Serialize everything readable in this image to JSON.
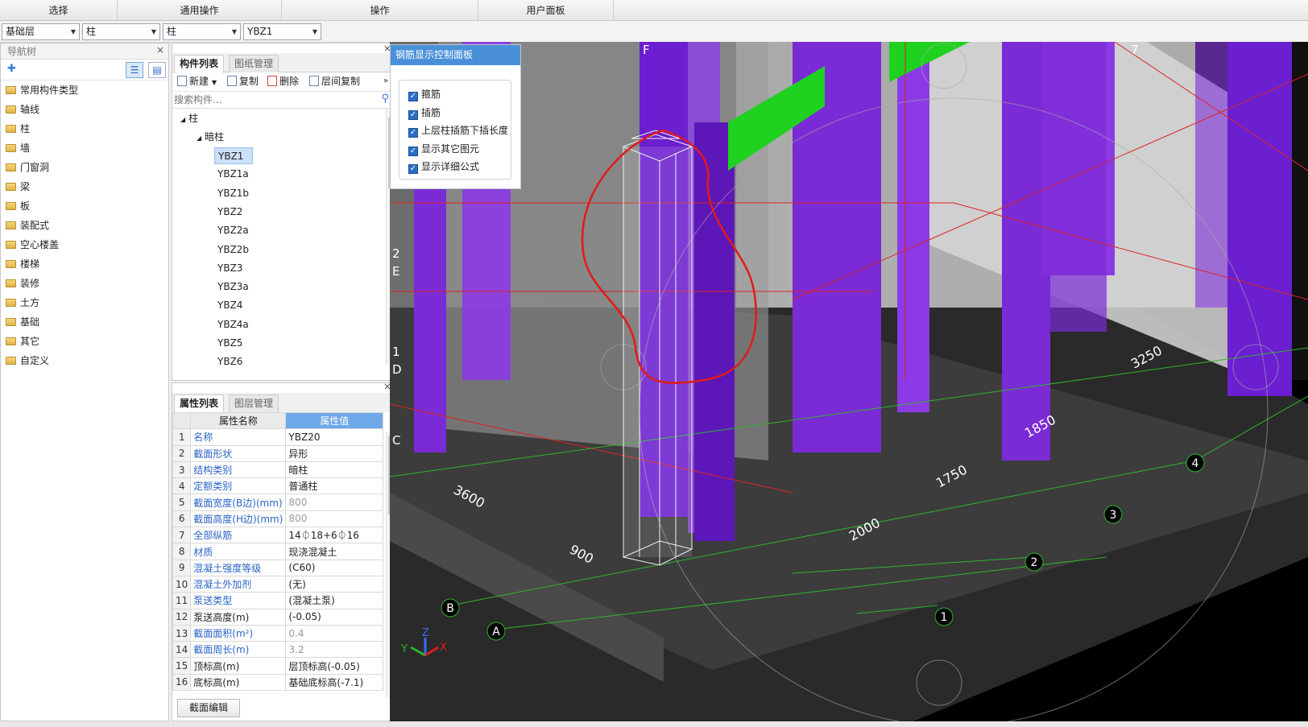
{
  "ribbon": {
    "tabs": [
      "选择",
      "通用操作",
      "操作",
      "用户面板"
    ]
  },
  "combos": {
    "floor": "基础层",
    "category": "柱",
    "subtype": "柱",
    "component": "YBZ1"
  },
  "nav": {
    "title": "导航树",
    "items": [
      "常用构件类型",
      "轴线",
      "柱",
      "墙",
      "门窗洞",
      "梁",
      "板",
      "装配式",
      "空心楼盖",
      "楼梯",
      "装修",
      "土方",
      "基础",
      "其它",
      "自定义"
    ]
  },
  "comp": {
    "tab_active": "构件列表",
    "tab_other": "图纸管理",
    "new_label": "新建",
    "copy_label": "复制",
    "delete_label": "删除",
    "floor_copy_label": "层间复制",
    "search_placeholder": "搜索构件...",
    "root": "柱",
    "group": "暗柱",
    "items": [
      "YBZ1",
      "YBZ1a",
      "YBZ1b",
      "YBZ2",
      "YBZ2a",
      "YBZ2b",
      "YBZ3",
      "YBZ3a",
      "YBZ4",
      "YBZ4a",
      "YBZ5",
      "YBZ6"
    ]
  },
  "props": {
    "tab_active": "属性列表",
    "tab_other": "图层管理",
    "col_name": "属性名称",
    "col_value": "属性值",
    "rows": [
      {
        "n": "1",
        "name": "名称",
        "value": "YBZ20",
        "blue": true,
        "gray": false
      },
      {
        "n": "2",
        "name": "截面形状",
        "value": "异形",
        "blue": true,
        "gray": false
      },
      {
        "n": "3",
        "name": "结构类别",
        "value": "暗柱",
        "blue": true,
        "gray": false
      },
      {
        "n": "4",
        "name": "定额类别",
        "value": "普通柱",
        "blue": true,
        "gray": false
      },
      {
        "n": "5",
        "name": "截面宽度(B边)(mm)",
        "value": "800",
        "blue": true,
        "gray": true
      },
      {
        "n": "6",
        "name": "截面高度(H边)(mm)",
        "value": "800",
        "blue": true,
        "gray": true
      },
      {
        "n": "7",
        "name": "全部纵筋",
        "value": "14⏀18+6⏀16",
        "blue": true,
        "gray": false
      },
      {
        "n": "8",
        "name": "材质",
        "value": "现浇混凝土",
        "blue": true,
        "gray": false
      },
      {
        "n": "9",
        "name": "混凝土强度等级",
        "value": "(C60)",
        "blue": true,
        "gray": false
      },
      {
        "n": "10",
        "name": "混凝土外加剂",
        "value": "(无)",
        "blue": true,
        "gray": false
      },
      {
        "n": "11",
        "name": "泵送类型",
        "value": "(混凝土泵)",
        "blue": true,
        "gray": false
      },
      {
        "n": "12",
        "name": "泵送高度(m)",
        "value": "(-0.05)",
        "blue": false,
        "gray": false
      },
      {
        "n": "13",
        "name": "截面面积(m²)",
        "value": "0.4",
        "blue": true,
        "gray": true
      },
      {
        "n": "14",
        "name": "截面周长(m)",
        "value": "3.2",
        "blue": true,
        "gray": true
      },
      {
        "n": "15",
        "name": "顶标高(m)",
        "value": "层顶标高(-0.05)",
        "blue": false,
        "gray": false
      },
      {
        "n": "16",
        "name": "底标高(m)",
        "value": "基础底标高(-7.1)",
        "blue": false,
        "gray": false
      }
    ],
    "edit_button": "截面编辑"
  },
  "control_panel": {
    "title": "钢筋显示控制面板",
    "options": [
      "箍筋",
      "插筋",
      "上层柱插筋下插长度",
      "显示其它图元",
      "显示详细公式"
    ]
  },
  "viewport": {
    "axis_labels": [
      "F",
      "7",
      "2",
      "E",
      "1",
      "D",
      "C",
      "B",
      "A",
      "4",
      "3",
      "2",
      "1"
    ],
    "dims": [
      "3600",
      "900",
      "2000",
      "1750",
      "1850",
      "3250"
    ],
    "gizmo": [
      "Z",
      "Y",
      "X"
    ]
  }
}
